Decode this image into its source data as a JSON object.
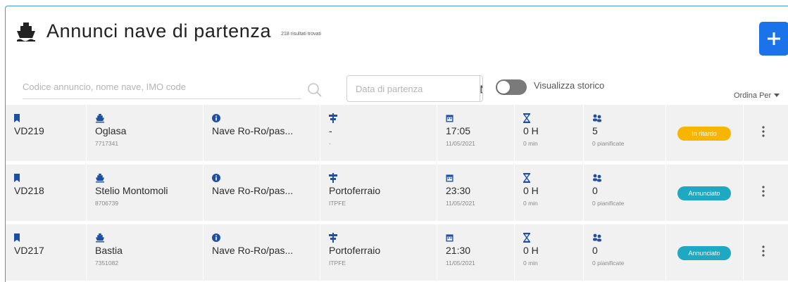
{
  "header": {
    "title": "Annunci nave di partenza",
    "subtitle": "218 risultati trovati"
  },
  "search": {
    "placeholder": "Codice annuncio, nome nave, IMO code",
    "date_placeholder": "Data di partenza"
  },
  "toggle": {
    "label": "Visualizza storico",
    "checked": false
  },
  "sort": {
    "label": "Ordina Per"
  },
  "colors": {
    "accent": "#1a73e8",
    "badge_in_ritardo": "#f7b500",
    "badge_annunciato": "#1ea8c2",
    "row_bg": "#f1f1f1",
    "icon_blue": "#1f4fa3"
  },
  "rows": [
    {
      "code": "VD219",
      "ship": "Oglasa",
      "imo": "7717341",
      "type": "Nave Ro-Ro/pas...",
      "port": "-",
      "port_code": "-",
      "time": "17:05",
      "date": "11/05/2021",
      "duration": "0 H",
      "duration_min": "0 min",
      "count": "5",
      "count_label": "0 pianificate",
      "status": "In ritardo",
      "status_color": "#f7b500"
    },
    {
      "code": "VD218",
      "ship": "Stelio Montomoli",
      "imo": "8706739",
      "type": "Nave Ro-Ro/pas...",
      "port": "Portoferraio",
      "port_code": "ITPFE",
      "time": "23:30",
      "date": "11/05/2021",
      "duration": "0 H",
      "duration_min": "0 min",
      "count": "0",
      "count_label": "0 pianificate",
      "status": "Annunciato",
      "status_color": "#1ea8c2"
    },
    {
      "code": "VD217",
      "ship": "Bastia",
      "imo": "7351082",
      "type": "Nave Ro-Ro/pas...",
      "port": "Portoferraio",
      "port_code": "ITPFE",
      "time": "21:30",
      "date": "11/05/2021",
      "duration": "0 H",
      "duration_min": "0 min",
      "count": "0",
      "count_label": "0 pianificate",
      "status": "Annunciato",
      "status_color": "#1ea8c2"
    }
  ]
}
